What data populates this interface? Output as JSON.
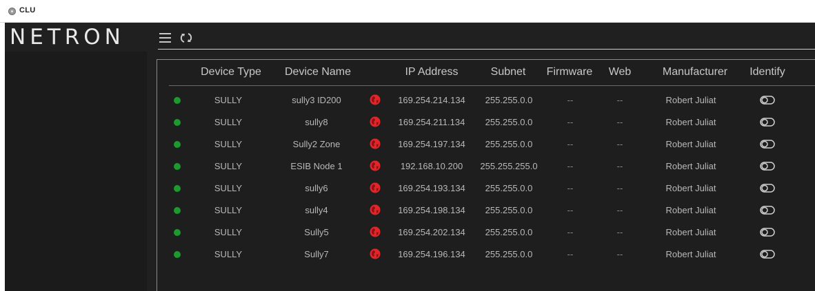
{
  "window": {
    "title": "CLU"
  },
  "brand": {
    "logo_text": "NETRON"
  },
  "toolbar": {
    "menu_icon": "hamburger-menu-icon",
    "refresh_icon": "refresh-icon"
  },
  "table": {
    "columns": [
      "Device Type",
      "Device Name",
      "IP Address",
      "Subnet",
      "Firmware",
      "Web",
      "Manufacturer",
      "Identify"
    ],
    "rows": [
      {
        "status": "online",
        "type": "SULLY",
        "name": "sully3 ID200",
        "ip": "169.254.214.134",
        "subnet": "255.255.0.0",
        "firmware": "--",
        "web": "--",
        "manufacturer": "Robert Juliat",
        "identify": "off"
      },
      {
        "status": "online",
        "type": "SULLY",
        "name": "sully8",
        "ip": "169.254.211.134",
        "subnet": "255.255.0.0",
        "firmware": "--",
        "web": "--",
        "manufacturer": "Robert Juliat",
        "identify": "off"
      },
      {
        "status": "online",
        "type": "SULLY",
        "name": "Sully2 Zone",
        "ip": "169.254.197.134",
        "subnet": "255.255.0.0",
        "firmware": "--",
        "web": "--",
        "manufacturer": "Robert Juliat",
        "identify": "off"
      },
      {
        "status": "online",
        "type": "SULLY",
        "name": "ESIB Node 1",
        "ip": "192.168.10.200",
        "subnet": "255.255.255.0",
        "firmware": "--",
        "web": "--",
        "manufacturer": "Robert Juliat",
        "identify": "off"
      },
      {
        "status": "online",
        "type": "SULLY",
        "name": "sully6",
        "ip": "169.254.193.134",
        "subnet": "255.255.0.0",
        "firmware": "--",
        "web": "--",
        "manufacturer": "Robert Juliat",
        "identify": "off"
      },
      {
        "status": "online",
        "type": "SULLY",
        "name": "sully4",
        "ip": "169.254.198.134",
        "subnet": "255.255.0.0",
        "firmware": "--",
        "web": "--",
        "manufacturer": "Robert Juliat",
        "identify": "off"
      },
      {
        "status": "online",
        "type": "SULLY",
        "name": "Sully5",
        "ip": "169.254.202.134",
        "subnet": "255.255.0.0",
        "firmware": "--",
        "web": "--",
        "manufacturer": "Robert Juliat",
        "identify": "off"
      },
      {
        "status": "online",
        "type": "SULLY",
        "name": "Sully7",
        "ip": "169.254.196.134",
        "subnet": "255.255.0.0",
        "firmware": "--",
        "web": "--",
        "manufacturer": "Robert Juliat",
        "identify": "off"
      }
    ]
  },
  "colors": {
    "status_online": "#1d9a2d",
    "web_icon": "#e0262b",
    "background": "#202020"
  }
}
